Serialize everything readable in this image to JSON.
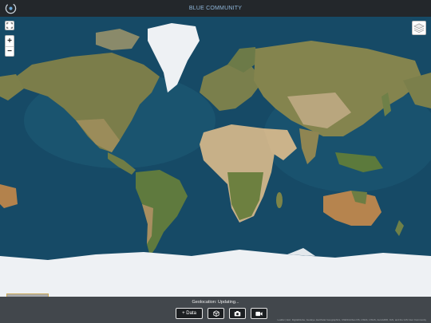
{
  "app": {
    "title": "BLUE COMMUNITY"
  },
  "map": {
    "controls": {
      "fullscreen_icon": "fullscreen-icon",
      "zoom_in_label": "+",
      "zoom_out_label": "−",
      "layers_icon": "layers-icon"
    },
    "scale_label": "3000 mi",
    "attribution": "Leaflet | Esri, DigitalGlobe, GeoEye, Earthstar Geographics, CNES/Airbus DS, USDA, USGS, AeroGRID, IGN, and the GIS User Community",
    "colors": {
      "ocean": "#164a66",
      "shelf": "#2e6f86",
      "land": "#8d8a55",
      "ice": "#eef1f4",
      "desert": "#c7b088"
    }
  },
  "footer": {
    "status": "Geolocation: Updating...",
    "buttons": {
      "data_label": "+ Data",
      "cube_icon": "cube-icon",
      "camera_icon": "camera-icon",
      "video_icon": "video-icon"
    }
  }
}
